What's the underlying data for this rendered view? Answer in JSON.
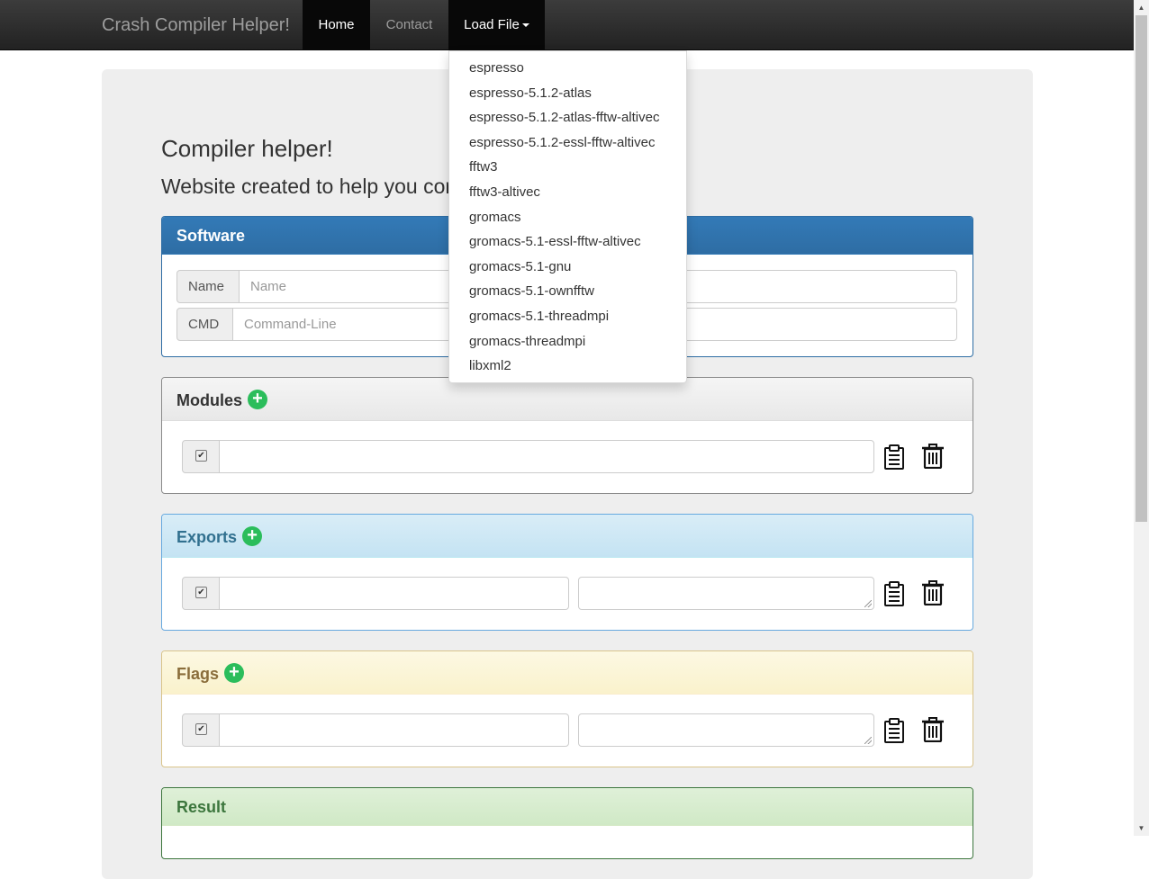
{
  "navbar": {
    "brand": "Crash Compiler Helper!",
    "home": "Home",
    "contact": "Contact",
    "load_file": "Load File"
  },
  "dropdown": {
    "items": [
      "espresso",
      "espresso-5.1.2-atlas",
      "espresso-5.1.2-atlas-fftw-altivec",
      "espresso-5.1.2-essl-fftw-altivec",
      "fftw3",
      "fftw3-altivec",
      "gromacs",
      "gromacs-5.1-essl-fftw-altivec",
      "gromacs-5.1-gnu",
      "gromacs-5.1-ownfftw",
      "gromacs-5.1-threadmpi",
      "gromacs-threadmpi",
      "libxml2"
    ]
  },
  "header": {
    "title": "Compiler helper!",
    "subtitle": "Website created to help you cor"
  },
  "software": {
    "heading": "Software",
    "name_label": "Name",
    "name_placeholder": "Name",
    "cmd_label": "CMD",
    "cmd_placeholder": "Command-Line"
  },
  "modules": {
    "heading": "Modules",
    "checked": true
  },
  "exports": {
    "heading": "Exports",
    "checked": true
  },
  "flags": {
    "heading": "Flags",
    "checked": true
  },
  "result": {
    "heading": "Result"
  },
  "icons": {
    "add": "plus-circle-icon",
    "copy": "clipboard-icon",
    "delete": "trash-icon",
    "checkbox_mark": "✔"
  },
  "colors": {
    "navbar": "#222222",
    "primary": "#337ab7",
    "info": "#31708f",
    "warning": "#8a6d3b",
    "success": "#3c763d",
    "add_button": "#2bbd5b"
  }
}
